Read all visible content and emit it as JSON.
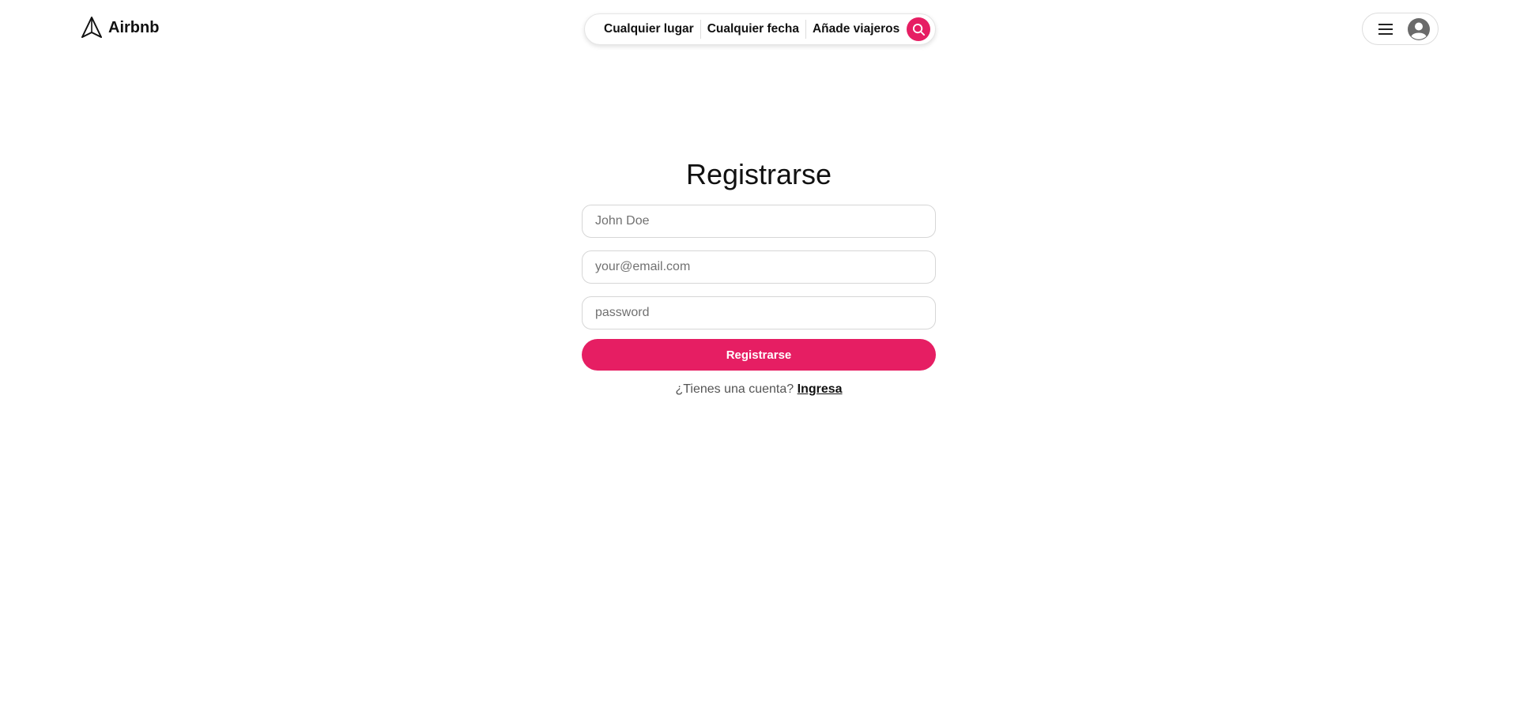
{
  "brand": {
    "name": "Airbnb",
    "logo_icon": "airbnb-logo-icon"
  },
  "search": {
    "location": "Cualquier lugar",
    "date": "Cualquier fecha",
    "guests": "Añade viajeros",
    "button_icon": "search-icon",
    "accent_color": "#e61e63"
  },
  "user_menu": {
    "menu_icon": "hamburger-menu-icon",
    "avatar_icon": "user-avatar-icon"
  },
  "form": {
    "title": "Registrarse",
    "name_placeholder": "John Doe",
    "email_placeholder": "your@email.com",
    "password_placeholder": "password",
    "submit_label": "Registrarse",
    "login_prompt": "¿Tienes una cuenta?",
    "login_link": "Ingresa"
  }
}
